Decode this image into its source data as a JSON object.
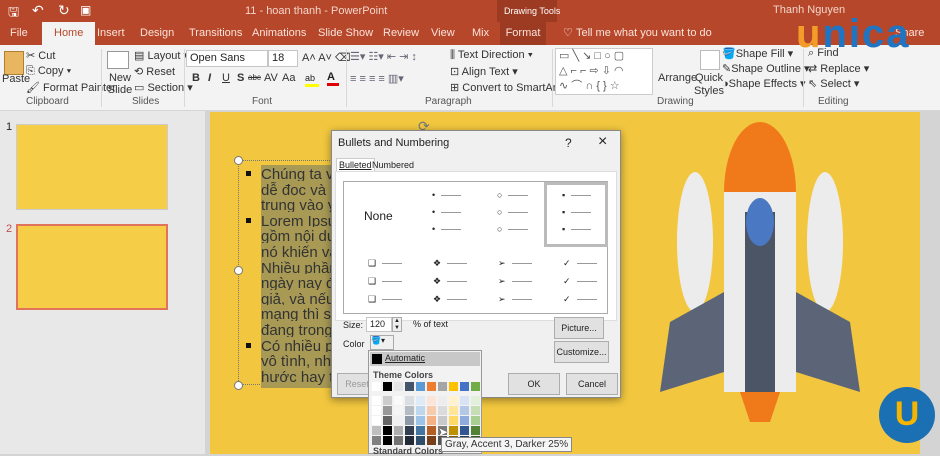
{
  "titlebar": {
    "quick_access": [
      "save-icon",
      "undo-icon",
      "redo-icon",
      "start-presentation-icon"
    ],
    "title": "11 - hoan thanh  -  PowerPoint",
    "context_tab": "Drawing Tools",
    "user": "Thanh Nguyen",
    "logo": "unica"
  },
  "tabs": [
    {
      "label": "File"
    },
    {
      "label": "Home",
      "active": true
    },
    {
      "label": "Insert"
    },
    {
      "label": "Design"
    },
    {
      "label": "Transitions"
    },
    {
      "label": "Animations"
    },
    {
      "label": "Slide Show"
    },
    {
      "label": "Review"
    },
    {
      "label": "View"
    },
    {
      "label": "Mix"
    },
    {
      "label": "Format"
    }
  ],
  "tell_me": "Tell me what you want to do",
  "share": "Share",
  "ribbon": {
    "clipboard": {
      "label": "Clipboard",
      "paste": "Paste",
      "cut": "Cut",
      "copy": "Copy",
      "format_painter": "Format Painter"
    },
    "slides": {
      "label": "Slides",
      "new_slide": "New Slide",
      "layout": "Layout",
      "reset": "Reset",
      "section": "Section"
    },
    "font": {
      "label": "Font",
      "font_name": "Open Sans",
      "font_size": "18",
      "bold": "B",
      "italic": "I",
      "underline": "U",
      "shadow": "S",
      "strike": "abc",
      "spacing": "AV",
      "case": "Aa",
      "highlight_color": "#ffff00",
      "font_color": "#e00000"
    },
    "paragraph": {
      "label": "Paragraph",
      "text_direction": "Text Direction",
      "align_text": "Align Text",
      "smartart": "Convert to SmartArt"
    },
    "drawing": {
      "label": "Drawing",
      "arrange": "Arrange",
      "quick_styles": "Quick Styles",
      "shape_fill": "Shape Fill",
      "shape_outline": "Shape Outline",
      "shape_effects": "Shape Effects"
    },
    "editing": {
      "label": "Editing",
      "find": "Find",
      "replace": "Replace",
      "select": "Select"
    }
  },
  "thumbnails": [
    {
      "number": "1"
    },
    {
      "number": "2",
      "selected": true
    }
  ],
  "slide": {
    "lines": [
      "Chúng ta vẫ",
      "dễ đọc và rõ",
      "trung vào yế",
      "Lorem Ipsun",
      "gồm nội dun",
      "nó khiến văn",
      "Nhiều phần",
      "ngày nay đã",
      "giả, và nếu b",
      "mạng thì sẽ",
      "đang trong",
      "Có nhiều ph",
      "vô tình, nhiề",
      "hước hay th"
    ],
    "bullet_rows": [
      0,
      3,
      11
    ]
  },
  "dialog": {
    "title": "Bullets and Numbering",
    "help": "?",
    "close": "×",
    "tabs": [
      "Bulleted",
      "Numbered"
    ],
    "none": "None",
    "bullets": [
      [
        "•",
        "○",
        "▪"
      ],
      [
        "❑",
        "❖",
        "➢",
        "✓"
      ]
    ],
    "size_label": "Size:",
    "size_value": "120",
    "size_unit": "% of text",
    "color_label": "Color",
    "picture": "Picture...",
    "customize": "Customize...",
    "reset": "Reset",
    "ok": "OK",
    "cancel": "Cancel"
  },
  "color_picker": {
    "automatic": "Automatic",
    "theme_header": "Theme Colors",
    "standard_header": "Standard Colors",
    "theme_colors": [
      "#ffffff",
      "#000000",
      "#e7e6e6",
      "#44546a",
      "#5b9bd5",
      "#ed7d31",
      "#a5a5a5",
      "#ffc000",
      "#4472c4",
      "#70ad47"
    ],
    "tooltip": "Gray, Accent 3, Darker 25%"
  }
}
